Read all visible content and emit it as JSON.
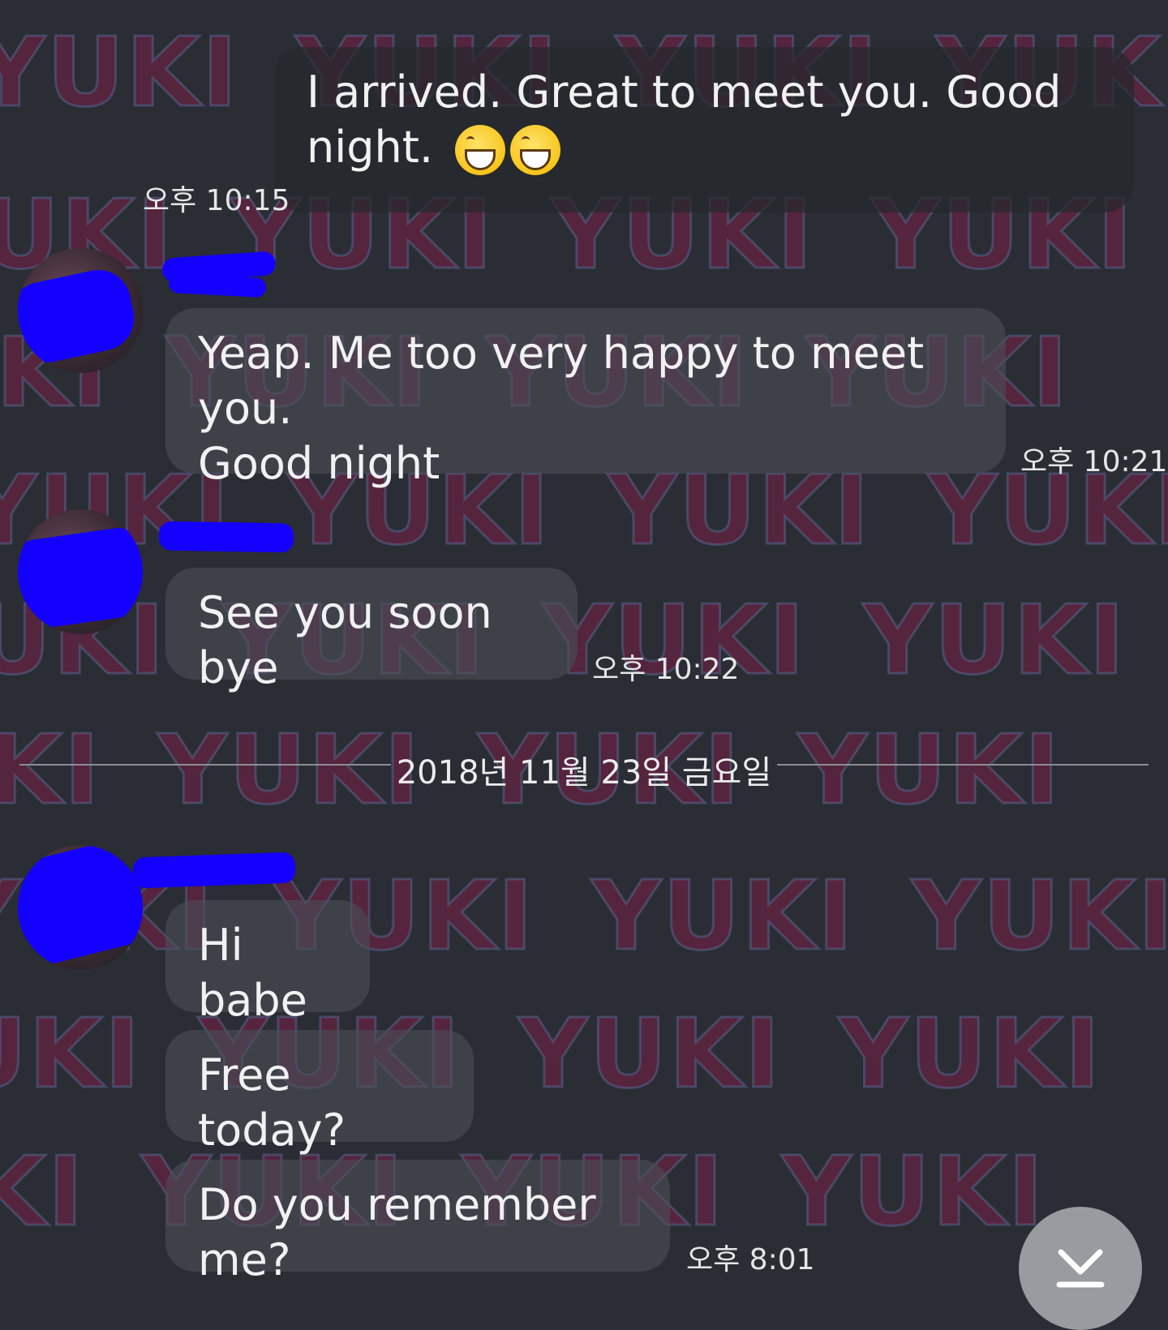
{
  "watermark": {
    "text": "YUKI"
  },
  "messages": [
    {
      "id": "msg-1",
      "text_line1": "I arrived.  Great to meet you. Good",
      "text_line2": "night.",
      "emoji": "grinning-face-emoji",
      "time": "오후 10:15"
    },
    {
      "id": "msg-2",
      "text_line1": "Yeap. Me too very happy to meet you.",
      "text_line2": "Good night",
      "time": "오후 10:21"
    },
    {
      "id": "msg-3",
      "text": "See you soon bye",
      "time": "오후 10:22"
    }
  ],
  "date_divider": "2018년 11월 23일 금요일",
  "messages_day2": [
    {
      "id": "msg-4",
      "text": "Hi babe"
    },
    {
      "id": "msg-5",
      "text": "Free today?"
    },
    {
      "id": "msg-6",
      "text": "Do you remember me?",
      "time": "오후 8:01"
    }
  ],
  "scroll_button": {
    "icon": "chevron-down-to-bottom-icon"
  },
  "colors": {
    "background": "#2a2d33",
    "redaction": "#1400ff",
    "watermark": "#7a1e46"
  }
}
